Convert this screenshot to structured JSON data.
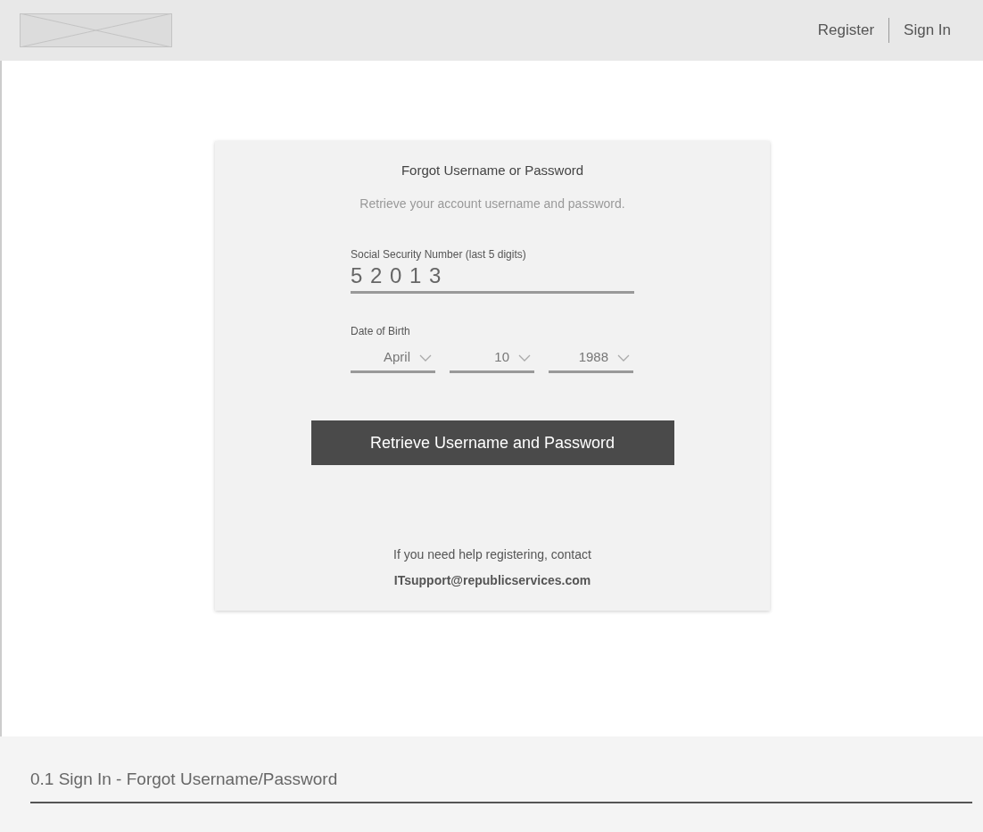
{
  "header": {
    "nav": [
      "Register",
      "Sign In"
    ]
  },
  "card": {
    "title": "Forgot Username or Password",
    "subtitle": "Retrieve your account username and password.",
    "ssn": {
      "label": "Social Security Number (last 5 digits)",
      "value": "5 2 0 1 3"
    },
    "dob": {
      "label": "Date of Birth",
      "selects": [
        "April",
        "10",
        "1988"
      ]
    },
    "button": "Retrieve Username and Password",
    "help": "If you need help registering, contact",
    "email": "ITsupport@republicservices.com"
  },
  "footer": {
    "caption": "0.1 Sign In - Forgot Username/Password"
  }
}
